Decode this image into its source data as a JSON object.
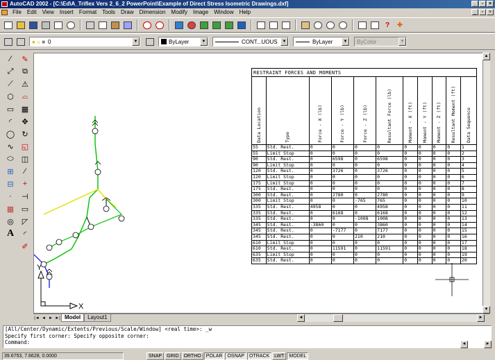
{
  "window": {
    "title": "AutoCAD 2002 - [C:\\Ed\\A_Triflex Vers 2_6_2 PowerPoint\\Example of Direct Stress Isometric Drawings.dxf]",
    "controls": [
      "_",
      "▫",
      "×"
    ]
  },
  "menu": [
    "File",
    "Edit",
    "View",
    "Insert",
    "Format",
    "Tools",
    "Draw",
    "Dimension",
    "Modify",
    "Image",
    "Window",
    "Help"
  ],
  "layer_toolbar": {
    "layer": "0",
    "color": "ByLayer",
    "linetype": "CONT...UOUS",
    "lineweight": "ByLayer",
    "plotstyle": "ByColor"
  },
  "colors": {
    "accent": "#0a246a",
    "pipe_green": "#00c000",
    "pipe_yellow": "#e0e000",
    "pipe_blue": "#0000ff",
    "canvas": "#ffffff"
  },
  "table": {
    "title": "RESTRAINT FORCES AND MOMENTS",
    "headers": [
      "Data Location",
      "Type",
      "Force - X (lb)",
      "Force - Y (lb)",
      "Force - Z (lb)",
      "Resultant Force (lb)",
      "Moment - X (ft)",
      "Moment - Y (ft)",
      "Moment - Z (ft)",
      "Resultant Moment (ft)",
      "Data Sequence"
    ],
    "rows": [
      [
        "55",
        "Std. Rest.",
        "0",
        "0",
        "0",
        "0",
        "0",
        "0",
        "0",
        "0",
        "1"
      ],
      [
        "55",
        "Limit Stop",
        "0",
        "0",
        "0",
        "0",
        "0",
        "0",
        "0",
        "0",
        "2"
      ],
      [
        "90",
        "Std. Rest.",
        "0",
        "6598",
        "0",
        "6598",
        "0",
        "0",
        "0",
        "0",
        "3"
      ],
      [
        "90",
        "Limit Stop",
        "0",
        "0",
        "0",
        "0",
        "0",
        "0",
        "0",
        "0",
        "4"
      ],
      [
        "120",
        "Std. Rest.",
        "0",
        "3726",
        "0",
        "3726",
        "0",
        "0",
        "0",
        "0",
        "5"
      ],
      [
        "120",
        "Limit Stop",
        "0",
        "0",
        "0",
        "0",
        "0",
        "0",
        "0",
        "0",
        "6"
      ],
      [
        "175",
        "Limit Stop",
        "0",
        "0",
        "0",
        "0",
        "0",
        "0",
        "0",
        "0",
        "7"
      ],
      [
        "175",
        "Std. Rest.",
        "0",
        "0",
        "0",
        "0",
        "0",
        "0",
        "0",
        "0",
        "8"
      ],
      [
        "300",
        "Std. Rest.",
        "0",
        "2780",
        "0",
        "2780",
        "0",
        "0",
        "0",
        "0",
        "9"
      ],
      [
        "300",
        "Limit Stop",
        "0",
        "0",
        "-765",
        "765",
        "0",
        "0",
        "0",
        "0",
        "10"
      ],
      [
        "335",
        "Std. Rest.",
        "4958",
        "0",
        "0",
        "4958",
        "0",
        "0",
        "0",
        "0",
        "11"
      ],
      [
        "335",
        "Std. Rest.",
        "0",
        "6168",
        "0",
        "6168",
        "0",
        "0",
        "0",
        "0",
        "12"
      ],
      [
        "335",
        "Std. Rest.",
        "0",
        "0",
        "-1008",
        "1008",
        "0",
        "0",
        "0",
        "0",
        "13"
      ],
      [
        "345",
        "Std. Rest.",
        "-3860",
        "0",
        "0",
        "3860",
        "0",
        "0",
        "0",
        "0",
        "14"
      ],
      [
        "345",
        "Std. Rest.",
        "0",
        "-7177",
        "0",
        "7177",
        "0",
        "0",
        "0",
        "0",
        "15"
      ],
      [
        "345",
        "Std. Rest.",
        "0",
        "0",
        "210",
        "210",
        "0",
        "0",
        "0",
        "0",
        "16"
      ],
      [
        "610",
        "Limit Stop",
        "0",
        "0",
        "0",
        "0",
        "0",
        "0",
        "0",
        "0",
        "17"
      ],
      [
        "610",
        "Std. Rest.",
        "0",
        "11591",
        "0",
        "11591",
        "0",
        "0",
        "0",
        "0",
        "18"
      ],
      [
        "635",
        "Limit Stop",
        "0",
        "0",
        "0",
        "0",
        "0",
        "0",
        "0",
        "0",
        "19"
      ],
      [
        "635",
        "Std. Rest.",
        "0",
        "0",
        "0",
        "0",
        "0",
        "0",
        "0",
        "0",
        "20"
      ]
    ]
  },
  "ucs": {
    "x_label": "X",
    "y_label": "Y"
  },
  "tabs": {
    "nav": [
      "|◄",
      "◄",
      "►",
      "►|"
    ],
    "items": [
      "Model",
      "Layout1"
    ]
  },
  "command_lines": [
    "[All/Center/Dynamic/Extents/Previous/Scale/Window] <real time>: _w",
    "Specify first corner: Specify opposite corner:",
    "Command:"
  ],
  "status": {
    "coords": "39.6753, 7.6628, 0.0000",
    "toggles": [
      "SNAP",
      "GRID",
      "ORTHO",
      "POLAR",
      "OSNAP",
      "OTRACK",
      "LWT",
      "MODEL"
    ]
  }
}
